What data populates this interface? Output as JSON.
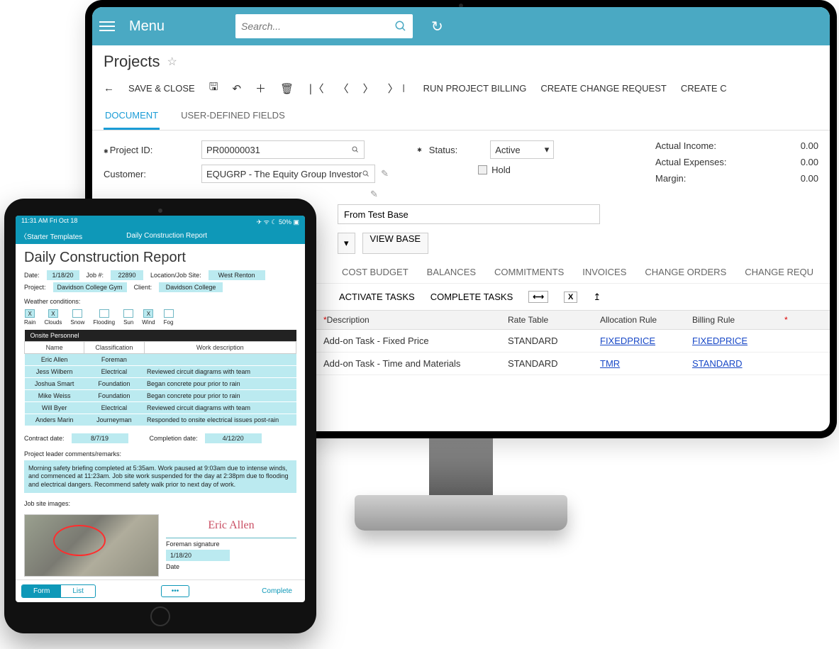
{
  "app": {
    "menu_label": "Menu",
    "search_placeholder": "Search...",
    "title": "Projects",
    "toolbar": {
      "save_close": "SAVE & CLOSE",
      "run_billing": "RUN PROJECT BILLING",
      "create_change": "CREATE CHANGE REQUEST",
      "create_more": "CREATE C"
    },
    "tabs": {
      "document": "DOCUMENT",
      "udf": "USER-DEFINED FIELDS"
    },
    "fields": {
      "project_id_label": "Project ID:",
      "project_id_value": "PR00000031",
      "customer_label": "Customer:",
      "customer_value": "EQUGRP - The Equity Group Investor",
      "status_label": "Status:",
      "status_value": "Active",
      "hold_label": "Hold",
      "base_input": "From Test Base"
    },
    "totals": {
      "actual_income_label": "Actual Income:",
      "actual_income_value": "0.00",
      "actual_expenses_label": "Actual Expenses:",
      "actual_expenses_value": "0.00",
      "margin_label": "Margin:",
      "margin_value": "0.00"
    },
    "view_base_btn": "VIEW BASE",
    "subtabs": {
      "cost": "COST BUDGET",
      "balances": "BALANCES",
      "commit": "COMMITMENTS",
      "invoices": "INVOICES",
      "change": "CHANGE ORDERS",
      "chgreq": "CHANGE REQU"
    },
    "taskbar": {
      "activate": "ACTIVATE TASKS",
      "complete": "COMPLETE TASKS"
    },
    "grid": {
      "head": {
        "desc": "Description",
        "rate": "Rate Table",
        "alloc": "Allocation Rule",
        "bill": "Billing Rule"
      },
      "rows": [
        {
          "desc": "Add-on Task - Fixed Price",
          "rate": "STANDARD",
          "alloc": "FIXEDPRICE",
          "bill": "FIXEDPRICE"
        },
        {
          "desc": "Add-on Task - Time and Materials",
          "rate": "STANDARD",
          "alloc": "TMR",
          "bill": "STANDARD"
        }
      ]
    }
  },
  "ipad": {
    "status_left": "11:31 AM   Fri Oct 18",
    "status_right": "✈ ᯤ  ☾  50% ▣",
    "nav_back": "Starter Templates",
    "nav_title": "Daily Construction Report",
    "heading": "Daily Construction Report",
    "date_label": "Date:",
    "date_value": "1/18/20",
    "job_label": "Job #:",
    "job_value": "22890",
    "loc_label": "Location/Job Site:",
    "loc_value": "West Renton",
    "project_label": "Project:",
    "project_value": "Davidson College Gym",
    "client_label": "Client:",
    "client_value": "Davidson College",
    "weather_label": "Weather conditions:",
    "weather": [
      {
        "label": "Rain",
        "checked": true
      },
      {
        "label": "Clouds",
        "checked": true
      },
      {
        "label": "Snow",
        "checked": false
      },
      {
        "label": "Flooding",
        "checked": false
      },
      {
        "label": "Sun",
        "checked": false
      },
      {
        "label": "Wind",
        "checked": true
      },
      {
        "label": "Fog",
        "checked": false
      }
    ],
    "personnel": {
      "title": "Onsite Personnel",
      "head": {
        "name": "Name",
        "class": "Classification",
        "work": "Work description"
      },
      "rows": [
        {
          "name": "Eric Allen",
          "class": "Foreman",
          "work": ""
        },
        {
          "name": "Jess Wilbern",
          "class": "Electrical",
          "work": "Reviewed circuit diagrams with team"
        },
        {
          "name": "Joshua Smart",
          "class": "Foundation",
          "work": "Began concrete pour prior to rain"
        },
        {
          "name": "Mike Weiss",
          "class": "Foundation",
          "work": "Began concrete pour prior to rain"
        },
        {
          "name": "Will Byer",
          "class": "Electrical",
          "work": "Reviewed circuit diagrams with team"
        },
        {
          "name": "Anders Marin",
          "class": "Journeyman",
          "work": "Responded to onsite electrical issues post-rain"
        }
      ]
    },
    "contract_label": "Contract date:",
    "contract_value": "8/7/19",
    "completion_label": "Completion date:",
    "completion_value": "4/12/20",
    "comments_label": "Project leader comments/remarks:",
    "comments_body": "Morning safety briefing completed at 5:35am. Work paused at 9:03am due to intense winds, and commenced at 11:23am. Job site work suspended for the day at 2:38pm due to flooding and electrical dangers. Recommend safety walk prior to next day of work.",
    "images_label": "Job site images:",
    "signature_value": "Eric Allen",
    "signature_label": "Foreman signature",
    "sign_date_value": "1/18/20",
    "sign_date_label": "Date",
    "bottom": {
      "form": "Form",
      "list": "List",
      "dots": "•••",
      "complete": "Complete"
    }
  }
}
